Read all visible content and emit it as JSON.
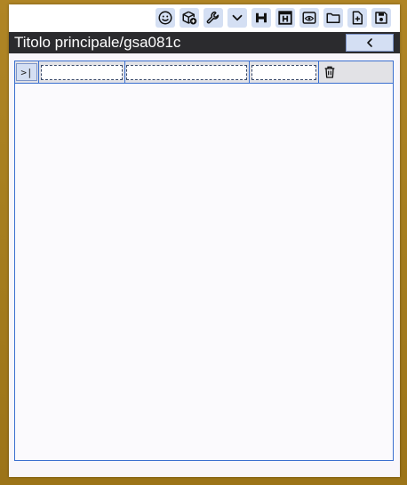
{
  "title": "Titolo principale/gsa081c",
  "toolbar": {
    "buttons": [
      {
        "name": "smiley-icon"
      },
      {
        "name": "package-add-icon"
      },
      {
        "name": "wrench-icon"
      },
      {
        "name": "chevron-down-icon"
      },
      {
        "name": "heading-icon"
      },
      {
        "name": "heading-box-icon"
      },
      {
        "name": "eye-icon"
      },
      {
        "name": "folder-icon"
      },
      {
        "name": "new-file-icon"
      },
      {
        "name": "save-icon"
      }
    ]
  },
  "back_button": {
    "icon": "chevron-left-icon"
  },
  "row": {
    "expand_label": ">|",
    "fields": [
      {
        "value": "",
        "placeholder": ""
      },
      {
        "value": "",
        "placeholder": ""
      },
      {
        "value": "",
        "placeholder": ""
      }
    ],
    "delete_icon": "trash-icon"
  },
  "colors": {
    "frame": "#a77f1f",
    "titlebar": "#2b2b2e",
    "button_bg": "#d4dff3",
    "panel_border": "#3a6fcf"
  }
}
